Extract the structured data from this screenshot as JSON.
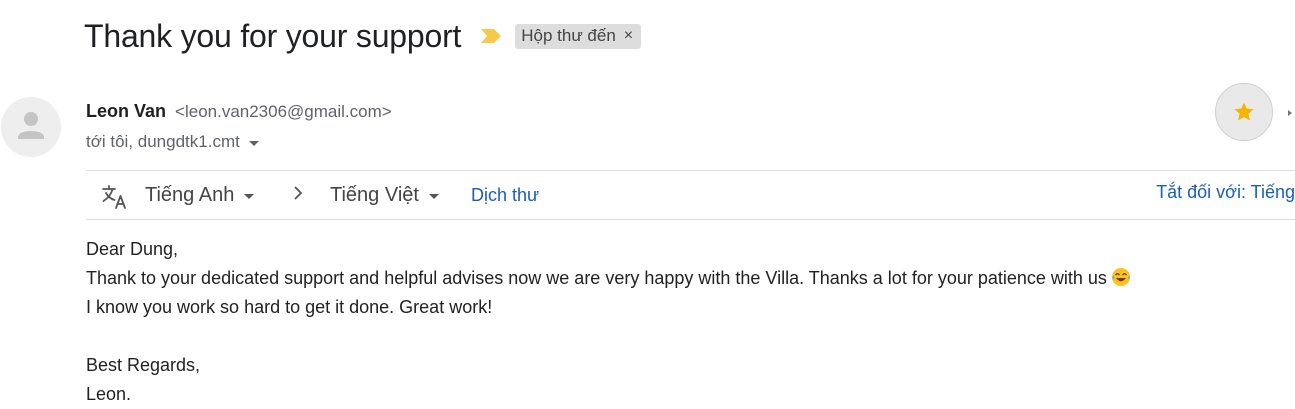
{
  "email": {
    "subject": "Thank you for your support",
    "label": "Hộp thư đến",
    "label_remove": "×",
    "importance_icon": "importance-marker-icon",
    "accent_color": "#f7c948",
    "sender": {
      "name": "Leon Van",
      "email": "<leon.van2306@gmail.com>",
      "recipients": "tới tôi, dungdtk1.cmt"
    },
    "star_color": "#f4b400"
  },
  "translate_bar": {
    "from_language": "Tiếng Anh",
    "to_language": "Tiếng Việt",
    "translate_link": "Dịch thư",
    "turn_off_link": "Tắt đối với: Tiếng",
    "link_color": "#1a5fb4"
  },
  "body": {
    "greeting": "Dear Dung,",
    "line1": "Thank to your dedicated support and helpful advises now we are very happy with the Villa. Thanks a lot for your patience with us",
    "line2": "I know you work so hard to get it done. Great work!",
    "closing": "Best Regards,",
    "signature": "Leon."
  }
}
